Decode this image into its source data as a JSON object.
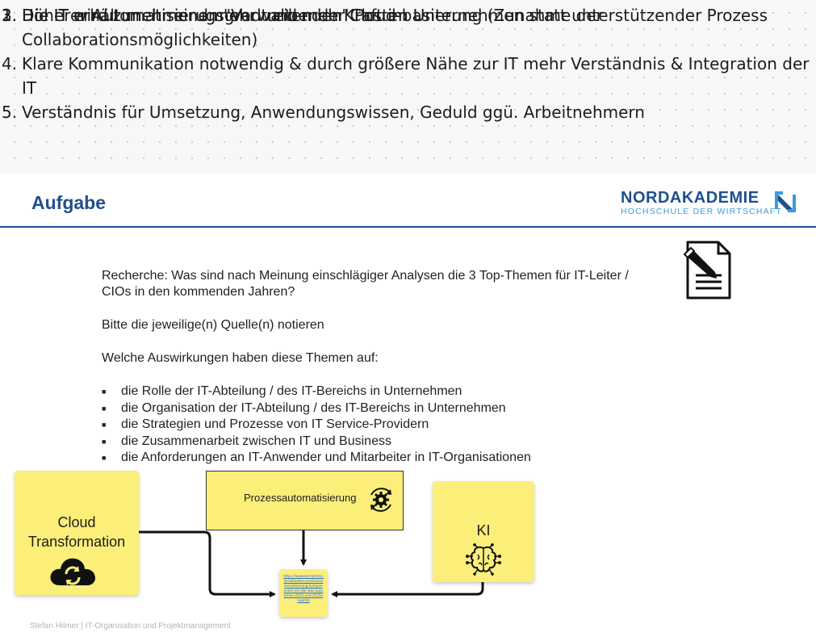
{
  "list": [
    {
      "num": "1.",
      "text": "Die IT erhält mehr einen \"Verwaltenden\" Posten"
    },
    {
      "num": "2.",
      "text": "Die IT wird zunehmend mehr treibende Kraft im Unternehmen statt unterstützender Prozess"
    },
    {
      "num": "3.",
      "text": "Höherer Automatisierugsgrad und mehr Cloud-basierung (Zunahme der Collaborationsmöglichkeiten)"
    },
    {
      "num": "4.",
      "text": "Klare Kommunikation notwendig & durch größere Nähe zur IT mehr Verständnis & Integration der IT"
    },
    {
      "num": "5.",
      "text": "Verständnis für Umsetzung, Anwendungswissen, Geduld ggü. Arbeitnehmern"
    }
  ],
  "slide": {
    "title": "Aufgabe",
    "logo_name": "NORDAKADEMIE",
    "logo_sub": "HOCHSCHULE DER WIRTSCHAFT",
    "question": "Recherche: Was sind nach Meinung einschlägiger Analysen die 3 Top-Themen für IT-Leiter / CIOs in den kommenden Jahren?",
    "sources": "Bitte die jeweilige(n) Quelle(n) notieren",
    "impact_intro": "Welche Auswirkungen haben diese Themen auf:",
    "bullets": [
      "die Rolle der IT-Abteilung / des IT-Bereichs in Unternehmen",
      "die Organisation der IT-Abteilung / des IT-Bereichs in Unternehmen",
      "die Strategien und Prozesse von IT Service-Providern",
      "die Zusammenarbeit zwischen IT und Business",
      "die Anforderungen an IT-Anwender und Mitarbeiter in IT-Organisationen"
    ],
    "footer": "Stefan Hilmer  |  IT-Organisation und Projektmanagement"
  },
  "stickies": {
    "cloud": {
      "line1": "Cloud",
      "line2": "Transformation",
      "icon": "cloud-sync-icon"
    },
    "process": {
      "label": "Prozessautomatisierung",
      "icon": "gear-cycle-icon"
    },
    "ki": {
      "label": "KI",
      "icon": "brain-circuit-icon"
    },
    "link": {
      "text": "https://www.bernardcio.de/aktuellen-prozessautomatisierung-komponenten-ein-der-was-ausstehen-2024-und-2025erwartet"
    }
  },
  "colors": {
    "sticky": "#fbef7a",
    "brand_blue": "#1f4f8f",
    "brand_light_blue": "#3a9be0"
  }
}
